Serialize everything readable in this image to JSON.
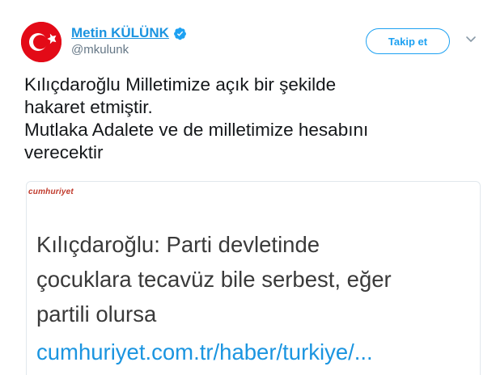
{
  "user": {
    "display_name": "Metin KÜLÜNK",
    "handle": "@mkulunk",
    "avatar_icon": "turkish-flag-icon",
    "verified_icon": "verified-badge-icon"
  },
  "follow_button": {
    "label": "Takip et"
  },
  "menu_icon": "chevron-down-icon",
  "tweet_text_lines": [
    "Kılıçdaroğlu Milletimize açık bir şekilde",
    "hakaret etmiştir.",
    "Mutlaka Adalete ve de milletimize hesabını",
    "verecektir"
  ],
  "card": {
    "source_label": "cumhuriyet",
    "headline_lines": [
      "Kılıçdaroğlu: Parti devletinde",
      "çocuklara tecavüz bile serbest, eğer",
      "partili olursa"
    ],
    "link": "cumhuriyet.com.tr/haber/turkiye/..."
  },
  "colors": {
    "accent": "#1da1f2",
    "name_link": "#1c94e0",
    "flag_red": "#e30a17",
    "text": "#14171a",
    "muted": "#657786"
  }
}
